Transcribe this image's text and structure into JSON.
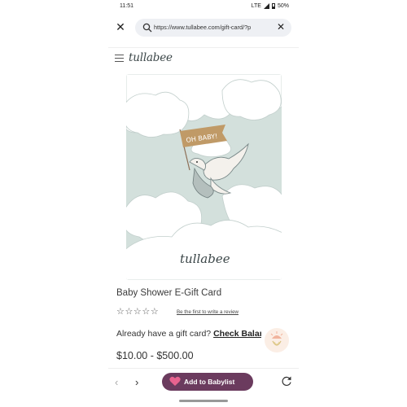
{
  "status_bar": {
    "time": "11:51",
    "network": "LTE",
    "battery": "50%"
  },
  "browser": {
    "url": "https://www.tullabee.com/gift-card/?p",
    "back_enabled": false
  },
  "site": {
    "logo": "tullabee"
  },
  "product": {
    "banner_text": "OH BABY!",
    "card_logo": "tullabee",
    "title": "Baby Shower E-Gift Card",
    "stars": "☆☆☆☆☆",
    "review_link": "Be the first to write a review",
    "gift_prompt": "Already have a gift card?",
    "check_balance": "Check Balar",
    "price": "$10.00 - $500.00"
  },
  "bottom_bar": {
    "add_label": "Add to Babylist"
  },
  "colors": {
    "brand_purple": "#6b3b5e",
    "heart_pink": "#e8638f",
    "banner_tan": "#c09a67"
  },
  "icons": [
    "close-icon",
    "search-icon",
    "clear-icon",
    "menu-icon",
    "account-icon",
    "gift-icon",
    "cart-icon",
    "back-icon",
    "forward-icon",
    "heart-icon",
    "reload-icon"
  ]
}
